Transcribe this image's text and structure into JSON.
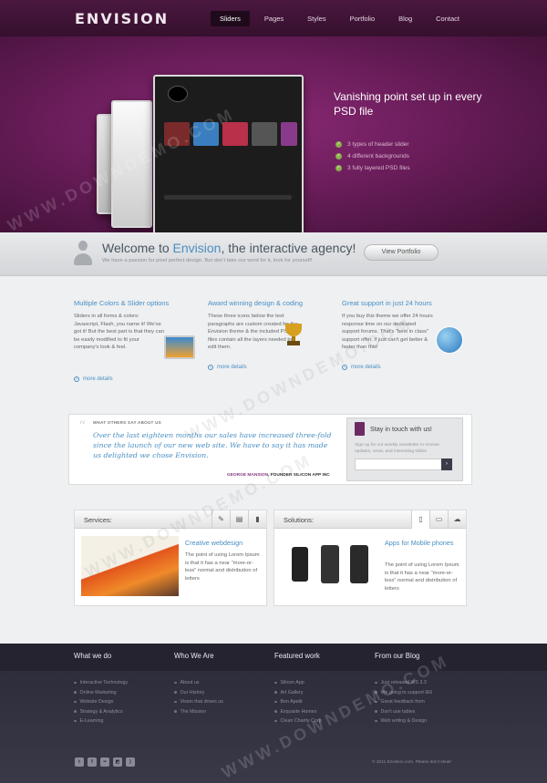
{
  "header": {
    "logo": "ENVISION",
    "nav": [
      "Sliders",
      "Pages",
      "Styles",
      "Portfolio",
      "Blog",
      "Contact"
    ],
    "active_nav": "Sliders"
  },
  "hero": {
    "title": "Vanishing point set up in every PSD file",
    "list": [
      "3 types of header slider",
      "4 different backgrounds",
      "3 fully layered PSD files"
    ],
    "colors": {
      "bg": "#6a1d5a",
      "check": "#8ab04a"
    }
  },
  "welcome": {
    "title_prefix": "Welcome to ",
    "title_brand": "Envision",
    "title_suffix": ", the interactive agency!",
    "subtitle": "We have a passion for pixel perfect design. But don't take our word for it, look for yourself!",
    "button": "View Portfolio"
  },
  "features": [
    {
      "title": "Multiple Colors & Slider options",
      "text": "Sliders in all forms & colors: Javascript, Flash, you name it! We've got it! But the best part is that they can be easily modified to fit your company's look & feel.",
      "more": "more details",
      "icon": "laptop-icon"
    },
    {
      "title": "Award winning design & coding",
      "text": "These three icons below the text paragraphs are custom created for the Envision theme & the included PSD files contain all the layers needed to edit them.",
      "more": "more details",
      "icon": "trophy-icon"
    },
    {
      "title": "Great support in just 24 hours",
      "text": "If you buy this theme we offer 24 hours response time on our dedicated support forums. That's \"best in class\" support offer, if just can't get better & faster than this!",
      "more": "more details",
      "icon": "globe-icon"
    }
  ],
  "testimonial": {
    "label": "WHAT OTHERS SAY ABOUT US",
    "quote": "Over the last eighteen months our sales have increased three-fold since the launch of our new web site. We have to say it has made us delighted we chose Envision.",
    "author_name": "GEORGE MANSION",
    "author_role": ", FOUNDER SILICON APP INC"
  },
  "newsletter": {
    "title": "Stay in touch with us!",
    "text": "Sign up for our weekly newsletter to receive updates, news, and interesting tidbits",
    "go": "›"
  },
  "services": {
    "title": "Services:",
    "subtitle": "Creative webdesign",
    "text": "The point of using Lorem Ipsum is that it has a near \"more-or-less\" normal and distribution of letters",
    "tabs": [
      "brush-icon",
      "printer-icon",
      "chart-icon"
    ]
  },
  "solutions": {
    "title": "Solutions:",
    "subtitle": "Apps for Mobile phones",
    "text": "The point of using Lorem Ipsum is that it has a near \"more-or-less\" normal and distribution of letters",
    "tabs": [
      "phone-icon",
      "monitor-icon",
      "cloud-icon"
    ]
  },
  "footer": {
    "columns": [
      {
        "title": "What we do",
        "items": [
          "Interactive Technology",
          "Online Marketing",
          "Website Design",
          "Strategy & Analytics",
          "E-Learning"
        ]
      },
      {
        "title": "Who We Are",
        "items": [
          "About us",
          "Our History",
          "Vision that drives us",
          "The Mission"
        ]
      },
      {
        "title": "Featured work",
        "items": [
          "Silicon App",
          "Art Gallery",
          "Bon Apetit",
          "Exquisite Homes",
          "Clean Charity Corp"
        ]
      },
      {
        "title": "From our Blog",
        "items": [
          "Just released WS 3.3",
          "We going to support IE6",
          "Great feedback from",
          "Don't use tables",
          "Web writing & Design"
        ]
      }
    ],
    "copyright": "© 2011 Envision.com. Please don't steal!",
    "social": [
      "twitter-icon",
      "facebook-icon",
      "flickr-icon",
      "delicious-icon",
      "rss-icon"
    ]
  },
  "watermark": "WWW.DOWNDEMO.COM"
}
